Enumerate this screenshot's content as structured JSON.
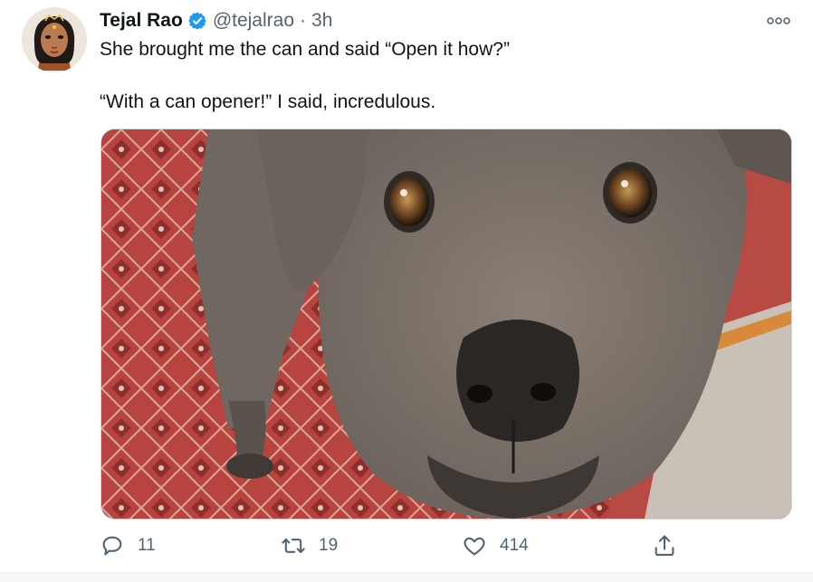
{
  "tweet": {
    "author_name": "Tejal Rao",
    "handle": "@tejalrao",
    "separator": "·",
    "time": "3h",
    "text_lines": [
      "She brought me the can and said “Open it how?”",
      "“With a can opener!” I said, incredulous."
    ]
  },
  "actions": {
    "reply_count": "11",
    "retweet_count": "19",
    "like_count": "414"
  },
  "icons": {
    "verified": "verified-badge-icon",
    "more": "more-options-icon",
    "reply": "reply-icon",
    "retweet": "retweet-icon",
    "like": "heart-icon",
    "share": "share-icon"
  },
  "colors": {
    "verified_blue": "#1d9bf0",
    "secondary_text": "#536471",
    "primary_text": "#0f1419"
  }
}
